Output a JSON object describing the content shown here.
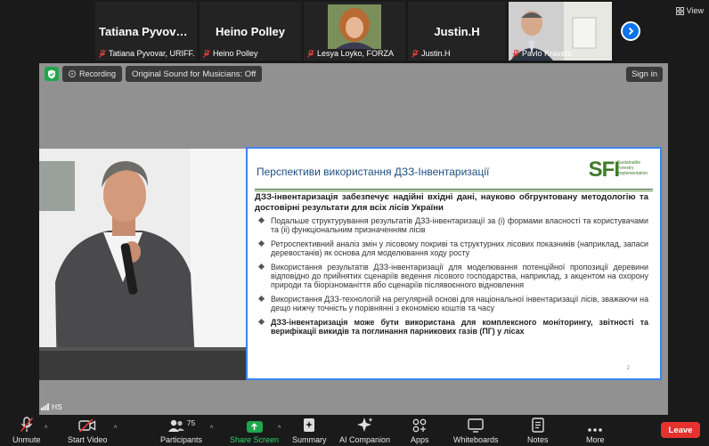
{
  "gallery": {
    "tiles": [
      {
        "big_name": "Tatiana Pyvovar,...",
        "label": "Tatiana Pyvovar, URIFF..."
      },
      {
        "big_name": "Heino Polley",
        "label": "Heino Polley"
      },
      {
        "big_name": "",
        "label": "Lesya Loyko, FORZA"
      },
      {
        "big_name": "Justin.H",
        "label": "Justin.H"
      },
      {
        "big_name": "",
        "label": "Pavlo Kravets"
      }
    ],
    "view_label": "View"
  },
  "meeting_bar": {
    "recording_label": "Recording",
    "original_sound_label": "Original Sound for Musicians: Off",
    "sign_in_label": "Sign in"
  },
  "speaker": {
    "name_label": "HS"
  },
  "slide": {
    "title": "Перспективи використання ДЗЗ-Інвентаризації",
    "logo": "SFI",
    "logo_subtitle": "Sustainable Forestry Implementation",
    "lead": "ДЗЗ-інвентаризація забезпечує надійні вхідні дані, науково обгрунтовану методологію та достовірні результати для всіх лісів України",
    "bullets": [
      "Подальше структурування результатів ДЗЗ-інвентаризації за (і) формами власності та користувачами та (іі) функціональним призначенням лісів",
      "Ретроспективний аналіз змін у лісовому покриві та структурних лісових показників (наприклад, запаси деревостанів) як основа для моделювання ходу росту",
      "Використання результатів ДЗЗ-інвентаризації для моделювання потенційної пропозиції деревини відповідно до прийнятих сценаріїв ведення лісового господарства, наприклад, з акцентом на охорону природи та біорізноманіття або сценаріїв післявоєнного відновлення",
      "Використання ДЗЗ-технологій на регулярній основі для національної інвентаризації лісів, зважаючи на дещо нижчу точність у порівнянні з економією коштів та часу",
      "ДЗЗ-інвентаризація може бути використана для комплексного моніторингу, звітності та верифікації викидів та поглинання парникових газів (ПГ) у лісах"
    ],
    "page_number": "2"
  },
  "toolbar": {
    "unmute": "Unmute",
    "start_video": "Start Video",
    "participants": "Participants",
    "participants_count": "75",
    "share_screen": "Share Screen",
    "summary": "Summary",
    "ai_companion": "AI Companion",
    "apps": "Apps",
    "whiteboards": "Whiteboards",
    "notes": "Notes",
    "more": "More",
    "leave": "Leave"
  },
  "colors": {
    "share_green": "#1fa64a",
    "leave_red": "#e5322d",
    "slide_border": "#3c84f0",
    "slide_title": "#1e4f84",
    "sfi_green": "#3f7a2a"
  }
}
